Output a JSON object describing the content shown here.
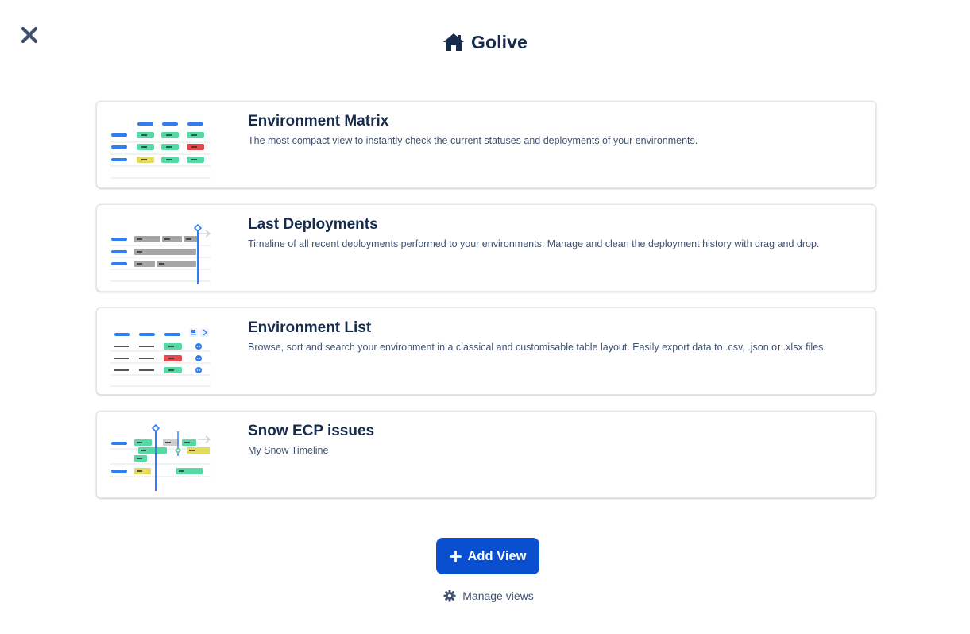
{
  "app": {
    "title": "Golive",
    "title_icon": "home-icon",
    "close_icon": "close-icon"
  },
  "views": [
    {
      "title": "Environment Matrix",
      "description": "The most compact view to instantly check the current statuses and deployments of your environments.",
      "thumbnail": "environment-matrix-thumbnail"
    },
    {
      "title": "Last Deployments",
      "description": "Timeline of all recent deployments performed to your environments. Manage and clean the deployment history with drag and drop.",
      "thumbnail": "last-deployments-thumbnail"
    },
    {
      "title": "Environment List",
      "description": "Browse, sort and search your environment in a classical and customisable table layout. Easily export data to .csv, .json or .xlsx files.",
      "thumbnail": "environment-list-thumbnail"
    },
    {
      "title": "Snow ECP issues",
      "description": "My Snow Timeline",
      "thumbnail": "timeline-thumbnail"
    }
  ],
  "actions": {
    "add_view_label": "Add View",
    "add_view_icon": "plus-icon",
    "manage_views_label": "Manage views",
    "manage_views_icon": "gear-icon"
  },
  "colors": {
    "primary": "#0b4fd1",
    "text": "#172b4d",
    "subtle_text": "#42526e",
    "blue_bar": "#2f7ef5",
    "green_status": "#57d9a3",
    "red_status": "#e5484d",
    "yellow_status": "#e2dc5a",
    "gray_status": "#a5a5a5"
  }
}
